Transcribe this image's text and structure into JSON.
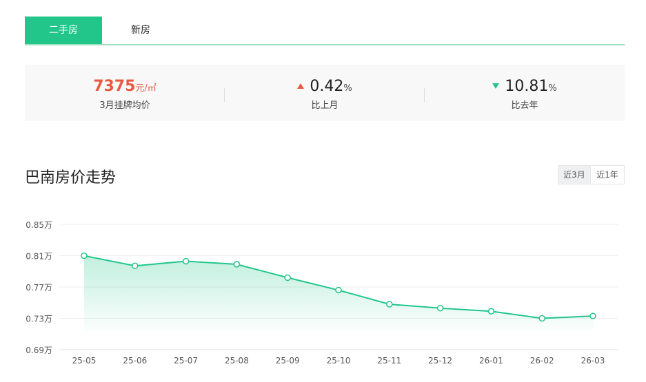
{
  "tabs": [
    {
      "label": "二手房"
    },
    {
      "label": "新房"
    }
  ],
  "summary": {
    "avg_price": {
      "value": "7375",
      "unit": "元/㎡",
      "label": "3月挂牌均价"
    },
    "mom": {
      "value": "0.42",
      "unit": "%",
      "label": "比上月",
      "direction": "up"
    },
    "yoy": {
      "value": "10.81",
      "unit": "%",
      "label": "比去年",
      "direction": "down"
    }
  },
  "chart_title": "巴南房价走势",
  "range_buttons": {
    "r3": "近3月",
    "r1": "近1年"
  },
  "colors": {
    "accent": "#22c68b",
    "up": "#e85a40",
    "down": "#22c68b"
  },
  "chart_data": {
    "type": "area",
    "categories": [
      "25-05",
      "25-06",
      "25-07",
      "25-08",
      "25-09",
      "25-10",
      "25-11",
      "25-12",
      "26-01",
      "26-02",
      "26-03"
    ],
    "series": [
      {
        "values": [
          0.81,
          0.797,
          0.803,
          0.799,
          0.782,
          0.766,
          0.748,
          0.743,
          0.739,
          0.73,
          0.733
        ]
      }
    ],
    "yticks": [
      0.85,
      0.81,
      0.77,
      0.73,
      0.69
    ],
    "ytick_labels": [
      "0.85万",
      "0.81万",
      "0.77万",
      "0.73万",
      "0.69万"
    ],
    "ylim": [
      0.69,
      0.85
    ],
    "grid": true,
    "legend": "none"
  }
}
